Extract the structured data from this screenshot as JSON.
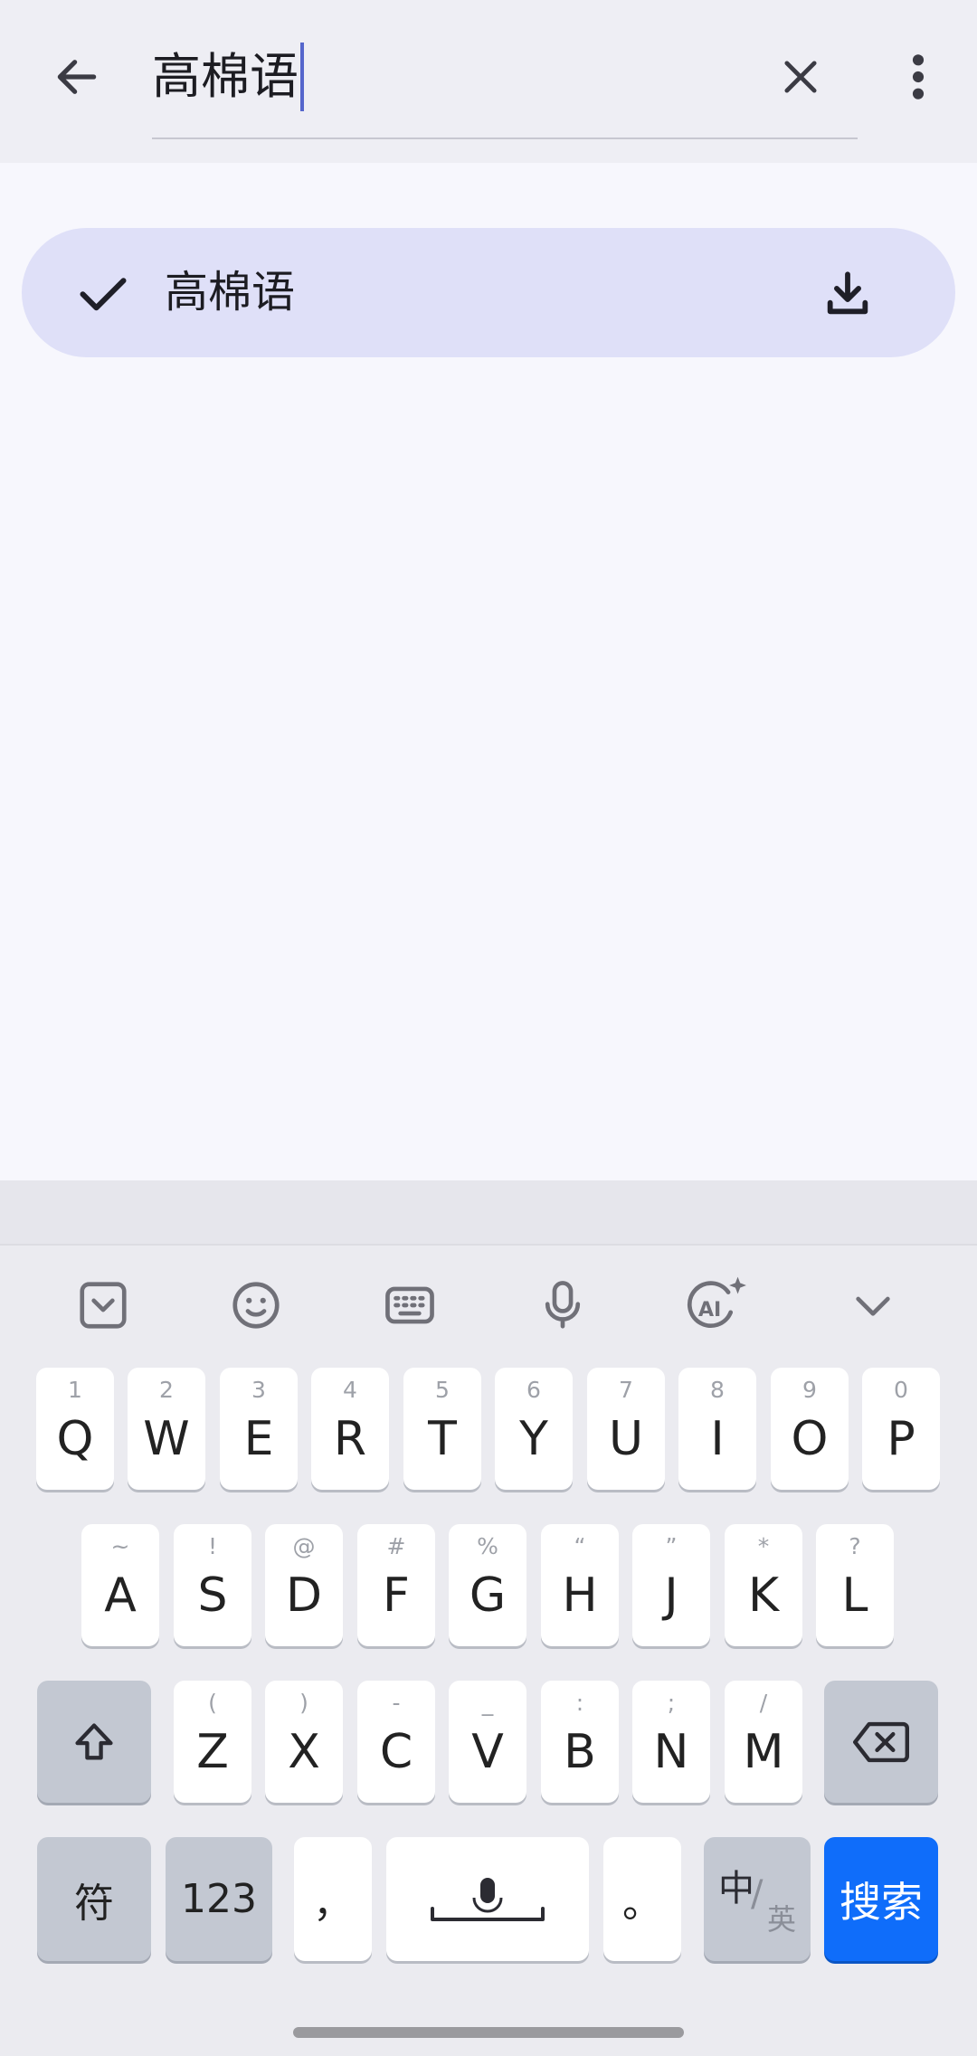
{
  "search": {
    "query": "高棉语"
  },
  "result": {
    "label": "高棉语"
  },
  "keyboard": {
    "row1": [
      {
        "hint": "1",
        "key": "Q"
      },
      {
        "hint": "2",
        "key": "W"
      },
      {
        "hint": "3",
        "key": "E"
      },
      {
        "hint": "4",
        "key": "R"
      },
      {
        "hint": "5",
        "key": "T"
      },
      {
        "hint": "6",
        "key": "Y"
      },
      {
        "hint": "7",
        "key": "U"
      },
      {
        "hint": "8",
        "key": "I"
      },
      {
        "hint": "9",
        "key": "O"
      },
      {
        "hint": "0",
        "key": "P"
      }
    ],
    "row2": [
      {
        "hint": "~",
        "key": "A"
      },
      {
        "hint": "!",
        "key": "S"
      },
      {
        "hint": "@",
        "key": "D"
      },
      {
        "hint": "#",
        "key": "F"
      },
      {
        "hint": "%",
        "key": "G"
      },
      {
        "hint": "“",
        "key": "H"
      },
      {
        "hint": "”",
        "key": "J"
      },
      {
        "hint": "*",
        "key": "K"
      },
      {
        "hint": "?",
        "key": "L"
      }
    ],
    "row3": [
      {
        "hint": "(",
        "key": "Z"
      },
      {
        "hint": ")",
        "key": "X"
      },
      {
        "hint": "-",
        "key": "C"
      },
      {
        "hint": "_",
        "key": "V"
      },
      {
        "hint": ":",
        "key": "B"
      },
      {
        "hint": ";",
        "key": "N"
      },
      {
        "hint": "/",
        "key": "M"
      }
    ],
    "symbols_label": "符",
    "numbers_label": "123",
    "comma_label": "，",
    "period_label": "。",
    "lang_main": "中",
    "lang_sub": "英",
    "search_label": "搜索"
  }
}
